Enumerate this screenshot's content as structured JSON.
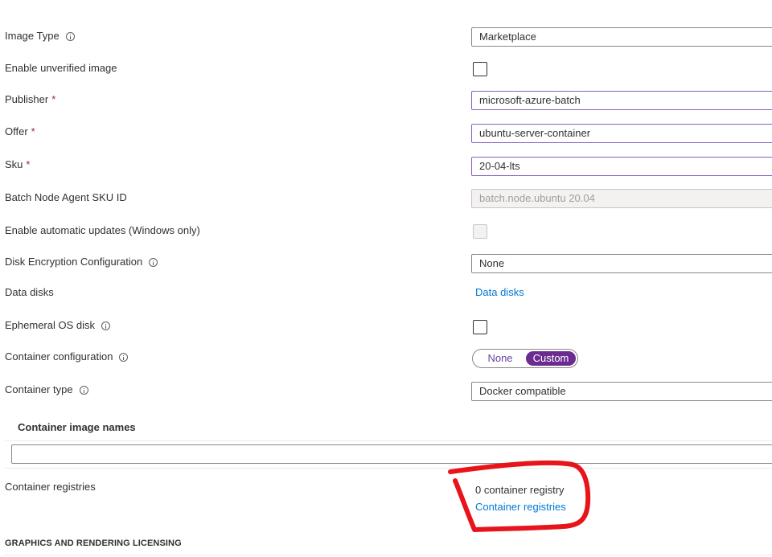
{
  "form": {
    "image_type": {
      "label": "Image Type",
      "value": "Marketplace"
    },
    "unverified_image": {
      "label": "Enable unverified image"
    },
    "publisher": {
      "label": "Publisher",
      "required": "*",
      "value": "microsoft-azure-batch"
    },
    "offer": {
      "label": "Offer",
      "required": "*",
      "value": "ubuntu-server-container"
    },
    "sku": {
      "label": "Sku",
      "required": "*",
      "value": "20-04-lts"
    },
    "node_agent_sku": {
      "label": "Batch Node Agent SKU ID",
      "value": "batch.node.ubuntu 20.04"
    },
    "auto_updates": {
      "label": "Enable automatic updates (Windows only)"
    },
    "disk_encryption": {
      "label": "Disk Encryption Configuration",
      "value": "None"
    },
    "data_disks": {
      "label": "Data disks",
      "link": "Data disks"
    },
    "ephemeral_os": {
      "label": "Ephemeral OS disk"
    },
    "container_config": {
      "label": "Container configuration",
      "options": [
        "None",
        "Custom"
      ],
      "selected": "Custom"
    },
    "container_type": {
      "label": "Container type",
      "value": "Docker compatible"
    }
  },
  "image_names": {
    "title": "Container image names",
    "value": ""
  },
  "registries": {
    "label": "Container registries",
    "count_text": "0 container registry",
    "link": "Container registries"
  },
  "licensing": {
    "title": "GRAPHICS AND RENDERING LICENSING"
  },
  "colors": {
    "accent_purple": "#6b2c91",
    "link_blue": "#0078d4",
    "required_red": "#a4262c",
    "annotation_red": "#e8141b"
  }
}
